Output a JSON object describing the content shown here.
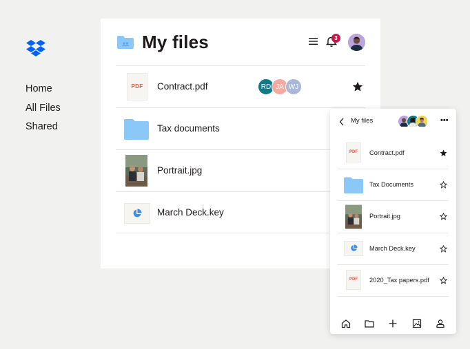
{
  "brand": {
    "logo_icon": "dropbox-logo-icon",
    "accent": "#0061fe"
  },
  "nav": {
    "items": [
      {
        "label": "Home"
      },
      {
        "label": "All Files"
      },
      {
        "label": "Shared"
      }
    ]
  },
  "main": {
    "title": "My files",
    "title_icon": "folder-icon",
    "header_icons": [
      "menu-icon",
      "bell-icon",
      "avatar"
    ],
    "notification_count": "3",
    "files": [
      {
        "name": "Contract.pdf",
        "type": "pdf",
        "type_label": "PDF",
        "starred": true,
        "collaborators": [
          {
            "initials": "RD",
            "color": "#0f7a8a"
          },
          {
            "initials": "JA",
            "color": "#f5a9a0"
          },
          {
            "initials": "WJ",
            "color": "#a9b8d6"
          }
        ]
      },
      {
        "name": "Tax documents",
        "type": "folder",
        "starred": false
      },
      {
        "name": "Portrait.jpg",
        "type": "image",
        "starred": false
      },
      {
        "name": "March Deck.key",
        "type": "keynote",
        "starred": false
      }
    ]
  },
  "mobile": {
    "title": "My files",
    "more_label": "•••",
    "files": [
      {
        "name": "Contract.pdf",
        "type": "pdf",
        "type_label": "PDF",
        "starred": true
      },
      {
        "name": "Tax Documents",
        "type": "folder",
        "starred": false
      },
      {
        "name": "Portrait.jpg",
        "type": "image",
        "starred": false
      },
      {
        "name": "March Deck.key",
        "type": "keynote",
        "starred": false
      },
      {
        "name": "2020_Tax papers.pdf",
        "type": "pdf",
        "type_label": "PDF",
        "starred": false
      }
    ],
    "tabs": [
      "home-icon",
      "folder-icon",
      "plus-icon",
      "photos-icon",
      "account-icon"
    ]
  },
  "colors": {
    "folder": "#8cc8f7",
    "pdf_label": "#e4543a",
    "keynote": "#3d8fe5",
    "badge": "#c8174a"
  }
}
